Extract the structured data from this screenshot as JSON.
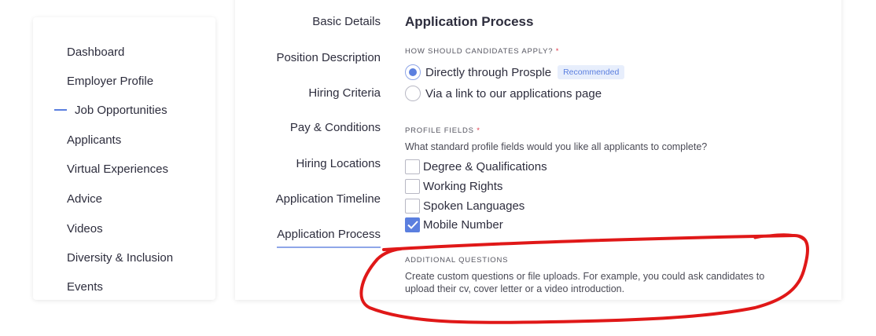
{
  "sidebar": {
    "items": [
      {
        "label": "Dashboard"
      },
      {
        "label": "Employer Profile"
      },
      {
        "label": "Job Opportunities",
        "active": true
      },
      {
        "label": "Applicants"
      },
      {
        "label": "Virtual Experiences"
      },
      {
        "label": "Advice"
      },
      {
        "label": "Videos"
      },
      {
        "label": "Diversity & Inclusion"
      },
      {
        "label": "Events"
      }
    ]
  },
  "steps": [
    {
      "label": "Basic Details"
    },
    {
      "label": "Position Description"
    },
    {
      "label": "Hiring Criteria"
    },
    {
      "label": "Pay & Conditions"
    },
    {
      "label": "Hiring Locations"
    },
    {
      "label": "Application Timeline"
    },
    {
      "label": "Application Process",
      "active": true
    }
  ],
  "section": {
    "title": "Application Process",
    "apply": {
      "label": "HOW SHOULD CANDIDATES APPLY?",
      "required_mark": "*",
      "options": [
        {
          "label": "Directly through Prosple",
          "selected": true,
          "badge": "Recommended"
        },
        {
          "label": "Via a link to our applications page",
          "selected": false
        }
      ]
    },
    "profile": {
      "label": "PROFILE FIELDS",
      "required_mark": "*",
      "help": "What standard profile fields would you like all applicants to complete?",
      "fields": [
        {
          "label": "Degree & Qualifications",
          "checked": false
        },
        {
          "label": "Working Rights",
          "checked": false
        },
        {
          "label": "Spoken Languages",
          "checked": false
        },
        {
          "label": "Mobile Number",
          "checked": true
        }
      ]
    },
    "additional": {
      "label": "ADDITIONAL QUESTIONS",
      "help_line1": "Create custom questions or file uploads. For example, you could ask candidates to",
      "help_line2": "upload their cv, cover letter or a video introduction."
    }
  },
  "colors": {
    "accent": "#5b7fdf",
    "badge_bg": "#e7eefc",
    "required": "#e0394a",
    "annotation": "#e01818"
  }
}
